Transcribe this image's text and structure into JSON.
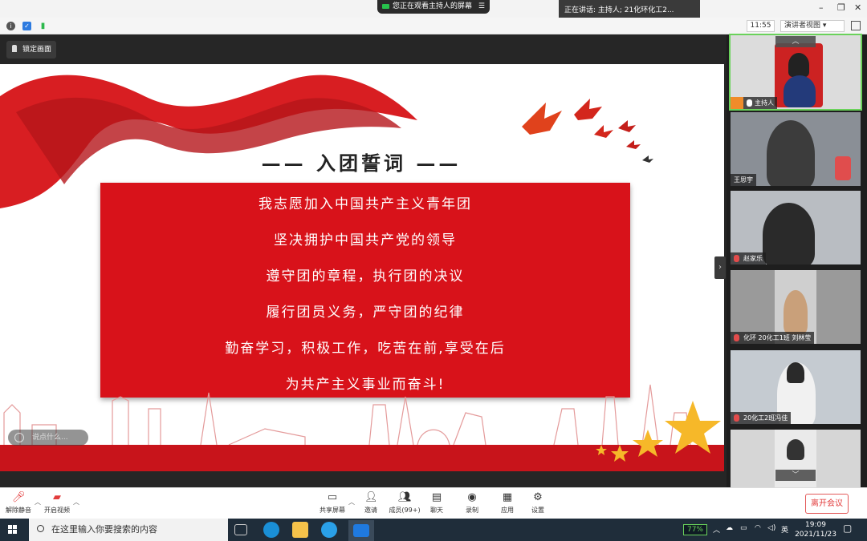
{
  "top": {
    "share_notice": "您正在观看主持人的屏幕",
    "speaking": "正在讲话: 主持人; 21化环化工2..."
  },
  "toolbar": {
    "time": "11:55",
    "view_mode": "演讲者视图"
  },
  "share": {
    "lock_label": "锁定画面",
    "search_hint": "说点什么..."
  },
  "slide": {
    "title": "—— 入团誓词 ——",
    "oath": [
      "我志愿加入中国共产主义青年团",
      "坚决拥护中国共产党的领导",
      "遵守团的章程，执行团的决议",
      "履行团员义务，严守团的纪律",
      "勤奋学习，积极工作，吃苦在前,享受在后",
      "为共产主义事业而奋斗!"
    ]
  },
  "participants": [
    {
      "name": "主持人"
    },
    {
      "name": "王思宇"
    },
    {
      "name": "赵家乐"
    },
    {
      "name": "化环 20化工1班 刘林莹"
    },
    {
      "name": "20化工2班冯佳"
    },
    {
      "name": ""
    }
  ],
  "bottom": {
    "unmute": "解除静音",
    "start_video": "开启视频",
    "share_screen": "共享屏幕",
    "invite": "邀请",
    "members": "成员(99+)",
    "chat": "聊天",
    "record": "录制",
    "apps": "应用",
    "settings": "设置",
    "leave": "离开会议"
  },
  "taskbar": {
    "search_placeholder": "在这里输入你要搜索的内容",
    "battery": "77%",
    "ime": "英",
    "time": "19:09",
    "date": "2021/11/23"
  },
  "colors": {
    "oath_red": "#d8121a",
    "accent_green": "#6ad25b",
    "leave_red": "#e23c3c"
  }
}
